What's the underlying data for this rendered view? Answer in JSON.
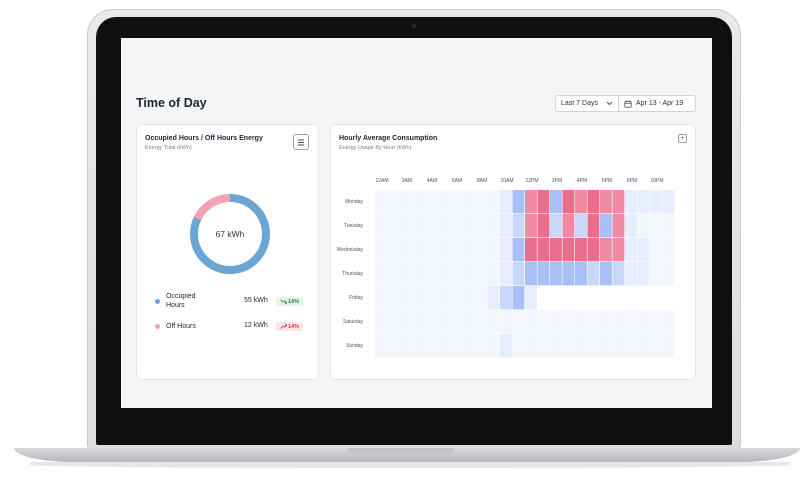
{
  "page": {
    "title": "Time of Day",
    "range_select": {
      "value": "Last 7 Days"
    },
    "date_range": {
      "value": "Apr 13 - Apr 19"
    }
  },
  "occupancy_card": {
    "title": "Occupied Hours / Off Hours Energy",
    "subtitle": "Energy Total (kWh)",
    "center_value": "67 kWh",
    "segments": [
      {
        "name": "Occupied Hours",
        "value": 55,
        "color": "#6aa5d4"
      },
      {
        "name": "Off Hours",
        "value": 12,
        "color": "#f4a3b7"
      }
    ],
    "legend": [
      {
        "label": "Occupied Hours",
        "value": "55 kWh",
        "change": "14%",
        "trend": "down",
        "dot_color": "#6aa5d4"
      },
      {
        "label": "Off Hours",
        "value": "12 kWh",
        "change": "14%",
        "trend": "up",
        "dot_color": "#f4a3b7"
      }
    ]
  },
  "hourly_card": {
    "title": "Hourly Average Consumption",
    "subtitle": "Energy Usage By Hour (kWh)",
    "hour_labels": [
      "12AM",
      "2AM",
      "4AM",
      "6AM",
      "8AM",
      "10AM",
      "12PM",
      "2PM",
      "4PM",
      "6PM",
      "8PM",
      "10PM"
    ],
    "days": [
      "Monday",
      "Tuesday",
      "Wednesday",
      "Thursday",
      "Friday",
      "Saturday",
      "Sunday"
    ],
    "colors": {
      "0": "#f3f6fd",
      "1": "#e6edfc",
      "2": "#c9d7fa",
      "3": "#a8c0f5",
      "4": "#f7b8c7",
      "5": "#f08aa3",
      "6": "#ea6e8c",
      "blank": "#ffffff"
    },
    "levels": [
      [
        0,
        0,
        0,
        0,
        0,
        0,
        0,
        0,
        0,
        0,
        1,
        3,
        5,
        6,
        3,
        6,
        5,
        6,
        5,
        5,
        1,
        1,
        1,
        1
      ],
      [
        0,
        0,
        0,
        0,
        0,
        0,
        0,
        0,
        0,
        0,
        1,
        2,
        5,
        6,
        2,
        5,
        2,
        6,
        3,
        5,
        1,
        0,
        0,
        0
      ],
      [
        0,
        0,
        0,
        0,
        0,
        0,
        0,
        0,
        0,
        0,
        1,
        3,
        6,
        6,
        6,
        6,
        6,
        6,
        5,
        5,
        1,
        1,
        0,
        0
      ],
      [
        0,
        0,
        0,
        0,
        0,
        0,
        0,
        0,
        0,
        0,
        1,
        2,
        3,
        3,
        3,
        3,
        3,
        2,
        3,
        2,
        1,
        1,
        0,
        0
      ],
      [
        0,
        0,
        0,
        0,
        0,
        0,
        0,
        0,
        0,
        1,
        2,
        3,
        1,
        "b",
        "b",
        "b",
        "b",
        "b",
        "b",
        "b",
        "b",
        "b",
        "b",
        "b"
      ],
      [
        0,
        0,
        0,
        0,
        0,
        0,
        0,
        0,
        0,
        0,
        0,
        0,
        0,
        0,
        0,
        0,
        0,
        0,
        0,
        0,
        0,
        0,
        0,
        0
      ],
      [
        0,
        0,
        0,
        0,
        0,
        0,
        0,
        0,
        0,
        0,
        1,
        0,
        0,
        0,
        0,
        0,
        0,
        0,
        0,
        0,
        0,
        0,
        0,
        0
      ]
    ]
  }
}
